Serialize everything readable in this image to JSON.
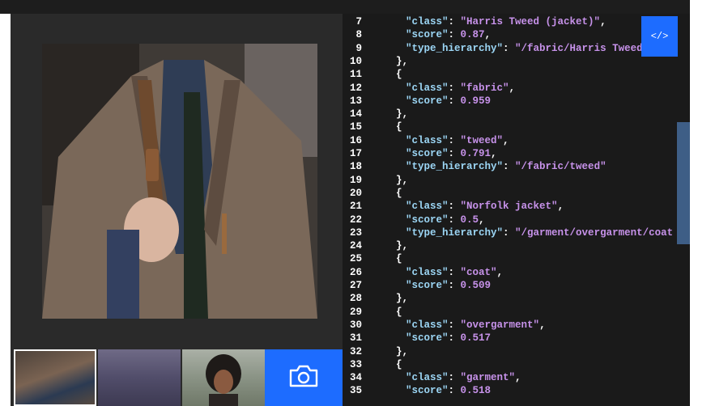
{
  "code_toggle": {
    "label": "</>"
  },
  "code_lines": [
    {
      "n": "7",
      "indent": 1,
      "parts": [
        [
          "k",
          "\"class\""
        ],
        [
          "p",
          ": "
        ],
        [
          "s",
          "\"Harris Tweed (jacket)\""
        ],
        [
          "p",
          ","
        ]
      ]
    },
    {
      "n": "8",
      "indent": 1,
      "parts": [
        [
          "k",
          "\"score\""
        ],
        [
          "p",
          ": "
        ],
        [
          "n",
          "0.87"
        ],
        [
          "p",
          ","
        ]
      ]
    },
    {
      "n": "9",
      "indent": 1,
      "parts": [
        [
          "k",
          "\"type_hierarchy\""
        ],
        [
          "p",
          ": "
        ],
        [
          "s",
          "\"/fabric/Harris Tweed\""
        ]
      ]
    },
    {
      "n": "10",
      "indent": 0,
      "parts": [
        [
          "p",
          "},"
        ]
      ]
    },
    {
      "n": "11",
      "indent": 0,
      "parts": [
        [
          "p",
          "{"
        ]
      ]
    },
    {
      "n": "12",
      "indent": 1,
      "parts": [
        [
          "k",
          "\"class\""
        ],
        [
          "p",
          ": "
        ],
        [
          "s",
          "\"fabric\""
        ],
        [
          "p",
          ","
        ]
      ]
    },
    {
      "n": "13",
      "indent": 1,
      "parts": [
        [
          "k",
          "\"score\""
        ],
        [
          "p",
          ": "
        ],
        [
          "n",
          "0.959"
        ]
      ]
    },
    {
      "n": "14",
      "indent": 0,
      "parts": [
        [
          "p",
          "},"
        ]
      ]
    },
    {
      "n": "15",
      "indent": 0,
      "parts": [
        [
          "p",
          "{"
        ]
      ]
    },
    {
      "n": "16",
      "indent": 1,
      "parts": [
        [
          "k",
          "\"class\""
        ],
        [
          "p",
          ": "
        ],
        [
          "s",
          "\"tweed\""
        ],
        [
          "p",
          ","
        ]
      ]
    },
    {
      "n": "17",
      "indent": 1,
      "parts": [
        [
          "k",
          "\"score\""
        ],
        [
          "p",
          ": "
        ],
        [
          "n",
          "0.791"
        ],
        [
          "p",
          ","
        ]
      ]
    },
    {
      "n": "18",
      "indent": 1,
      "parts": [
        [
          "k",
          "\"type_hierarchy\""
        ],
        [
          "p",
          ": "
        ],
        [
          "s",
          "\"/fabric/tweed\""
        ]
      ]
    },
    {
      "n": "19",
      "indent": 0,
      "parts": [
        [
          "p",
          "},"
        ]
      ]
    },
    {
      "n": "20",
      "indent": 0,
      "parts": [
        [
          "p",
          "{"
        ]
      ]
    },
    {
      "n": "21",
      "indent": 1,
      "parts": [
        [
          "k",
          "\"class\""
        ],
        [
          "p",
          ": "
        ],
        [
          "s",
          "\"Norfolk jacket\""
        ],
        [
          "p",
          ","
        ]
      ]
    },
    {
      "n": "22",
      "indent": 1,
      "parts": [
        [
          "k",
          "\"score\""
        ],
        [
          "p",
          ": "
        ],
        [
          "n",
          "0.5"
        ],
        [
          "p",
          ","
        ]
      ]
    },
    {
      "n": "23",
      "indent": 1,
      "parts": [
        [
          "k",
          "\"type_hierarchy\""
        ],
        [
          "p",
          ": "
        ],
        [
          "s",
          "\"/garment/overgarment/coat"
        ]
      ]
    },
    {
      "n": "24",
      "indent": 0,
      "parts": [
        [
          "p",
          "},"
        ]
      ]
    },
    {
      "n": "25",
      "indent": 0,
      "parts": [
        [
          "p",
          "{"
        ]
      ]
    },
    {
      "n": "26",
      "indent": 1,
      "parts": [
        [
          "k",
          "\"class\""
        ],
        [
          "p",
          ": "
        ],
        [
          "s",
          "\"coat\""
        ],
        [
          "p",
          ","
        ]
      ]
    },
    {
      "n": "27",
      "indent": 1,
      "parts": [
        [
          "k",
          "\"score\""
        ],
        [
          "p",
          ": "
        ],
        [
          "n",
          "0.509"
        ]
      ]
    },
    {
      "n": "28",
      "indent": 0,
      "parts": [
        [
          "p",
          "},"
        ]
      ]
    },
    {
      "n": "29",
      "indent": 0,
      "parts": [
        [
          "p",
          "{"
        ]
      ]
    },
    {
      "n": "30",
      "indent": 1,
      "parts": [
        [
          "k",
          "\"class\""
        ],
        [
          "p",
          ": "
        ],
        [
          "s",
          "\"overgarment\""
        ],
        [
          "p",
          ","
        ]
      ]
    },
    {
      "n": "31",
      "indent": 1,
      "parts": [
        [
          "k",
          "\"score\""
        ],
        [
          "p",
          ": "
        ],
        [
          "n",
          "0.517"
        ]
      ]
    },
    {
      "n": "32",
      "indent": 0,
      "parts": [
        [
          "p",
          "},"
        ]
      ]
    },
    {
      "n": "33",
      "indent": 0,
      "parts": [
        [
          "p",
          "{"
        ]
      ]
    },
    {
      "n": "34",
      "indent": 1,
      "parts": [
        [
          "k",
          "\"class\""
        ],
        [
          "p",
          ": "
        ],
        [
          "s",
          "\"garment\""
        ],
        [
          "p",
          ","
        ]
      ]
    },
    {
      "n": "35",
      "indent": 1,
      "parts": [
        [
          "k",
          "\"score\""
        ],
        [
          "p",
          ": "
        ],
        [
          "n",
          "0.518"
        ]
      ]
    }
  ],
  "colors": {
    "accent": "#1d6cff",
    "key": "#9cd6f5",
    "value": "#c792ea",
    "panel": "#1a1a1a",
    "side_tab": "#3e5e86"
  },
  "icons": {
    "camera": "camera-icon",
    "code": "code-icon"
  }
}
